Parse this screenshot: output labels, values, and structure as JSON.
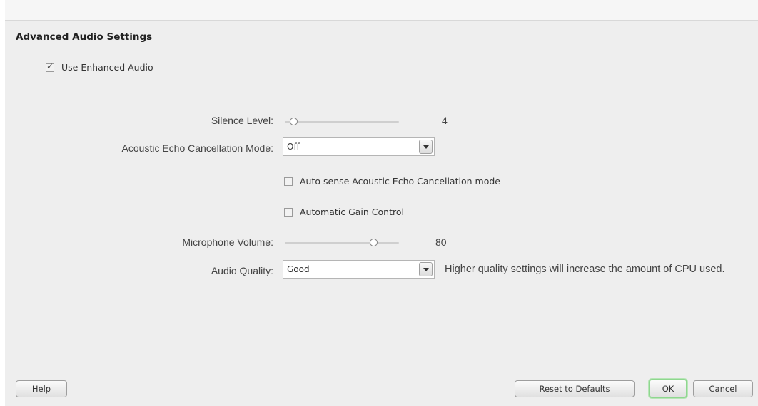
{
  "dialog": {
    "title": "Advanced Audio Settings"
  },
  "enhanced_audio": {
    "label": "Use Enhanced Audio",
    "checked": true
  },
  "silence_level": {
    "label": "Silence Level:",
    "value": "4",
    "fraction": 0.05
  },
  "echo_cancellation": {
    "label": "Acoustic Echo Cancellation Mode:",
    "value": "Off",
    "auto_sense_label": "Auto sense Acoustic Echo Cancellation mode",
    "auto_sense_checked": false
  },
  "gain_control": {
    "label": "Automatic Gain Control",
    "checked": false
  },
  "microphone_volume": {
    "label": "Microphone Volume:",
    "value": "80",
    "fraction": 0.8
  },
  "audio_quality": {
    "label": "Audio Quality:",
    "value": "Good",
    "hint": "Higher quality settings will increase the amount of CPU used."
  },
  "buttons": {
    "help": "Help",
    "reset": "Reset to Defaults",
    "ok": "OK",
    "cancel": "Cancel"
  }
}
